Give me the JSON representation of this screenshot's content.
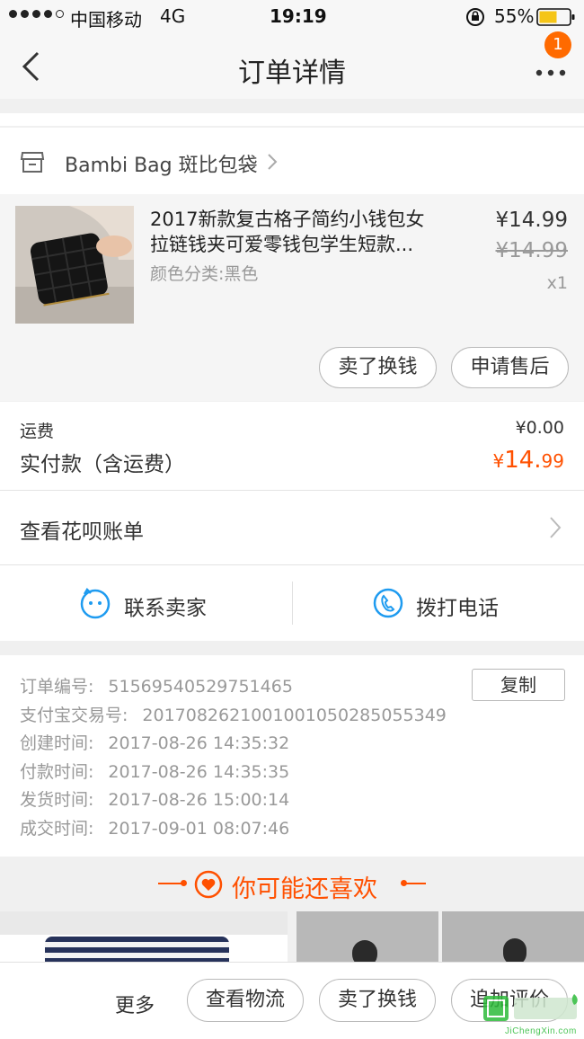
{
  "status_bar": {
    "carrier": "中国移动",
    "network": "4G",
    "time": "19:19",
    "battery": "55%"
  },
  "nav": {
    "title": "订单详情",
    "badge": "1"
  },
  "shop": {
    "name": "Bambi Bag 斑比包袋"
  },
  "product": {
    "title_line1": "2017新款复古格子简约小钱包女",
    "title_line2": "拉链钱夹可爱零钱包学生短款...",
    "sku": "颜色分类:黑色",
    "price": "¥14.99",
    "original_price": "¥14.99",
    "quantity": "x1"
  },
  "product_actions": {
    "sell_label": "卖了换钱",
    "after_sale_label": "申请售后"
  },
  "summary": {
    "shipping_label": "运费",
    "shipping_value": "¥0.00",
    "paid_label": "实付款（含运费）",
    "paid_currency": "¥",
    "paid_main": "14.",
    "paid_decimal": "99"
  },
  "huabei": {
    "label": "查看花呗账单"
  },
  "contact": {
    "seller_label": "联系卖家",
    "phone_label": "拨打电话"
  },
  "order_info": {
    "copy_label": "复制",
    "rows": [
      {
        "label": "订单编号:",
        "value": "51569540529751465"
      },
      {
        "label": "支付宝交易号:",
        "value": "2017082621001001050285055349"
      },
      {
        "label": "创建时间:",
        "value": "2017-08-26 14:35:32"
      },
      {
        "label": "付款时间:",
        "value": "2017-08-26 14:35:35"
      },
      {
        "label": "发货时间:",
        "value": "2017-08-26 15:00:14"
      },
      {
        "label": "成交时间:",
        "value": "2017-09-01 08:07:46"
      }
    ]
  },
  "recommend": {
    "title": "你可能还喜欢"
  },
  "bottom_bar": {
    "more_label": "更多",
    "logistics_label": "查看物流",
    "sell_label": "卖了换钱",
    "review_label": "追加评价"
  },
  "watermark": {
    "text": "JiChengXin.com"
  },
  "colors": {
    "accent": "#ff5000",
    "icon_blue": "#1e9bf0",
    "badge": "#ff6a00"
  }
}
